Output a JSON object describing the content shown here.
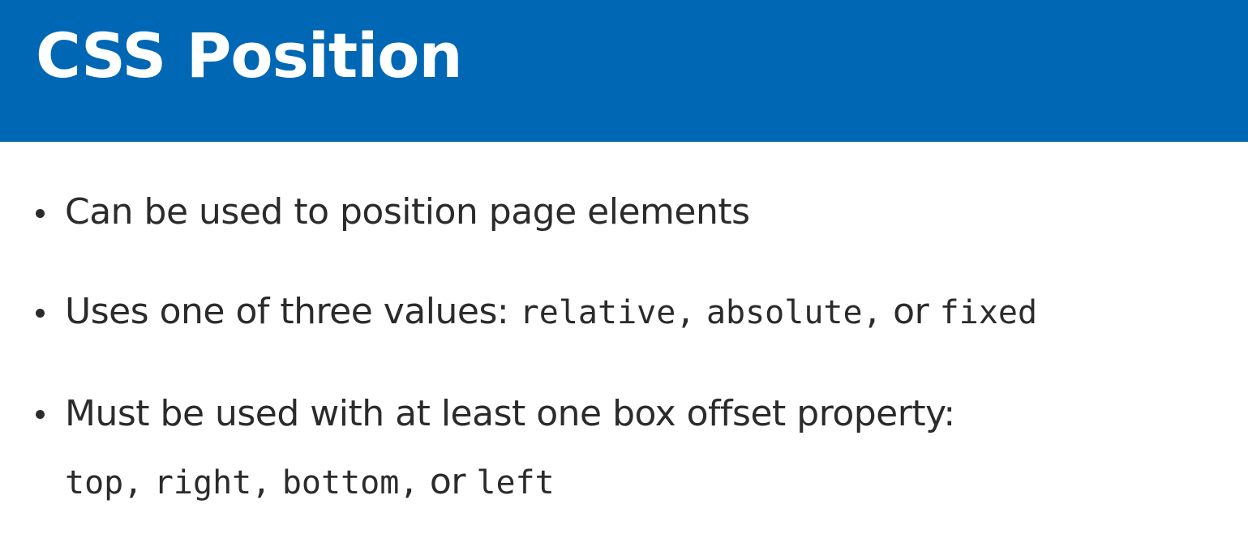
{
  "header": {
    "title": "CSS Position",
    "background_color": "#0067b4"
  },
  "bullets": [
    {
      "text": "Can be used to position page elements"
    },
    {
      "text": "Uses one of three values: ",
      "code1": "relative,",
      "code2": "absolute,",
      "sep": " or ",
      "code3": "fixed"
    },
    {
      "text": "Must be used with at least one box offset property:",
      "code1": "top,",
      "code2": "right,",
      "code3": "bottom,",
      "sep": " or ",
      "code4": "left"
    }
  ]
}
